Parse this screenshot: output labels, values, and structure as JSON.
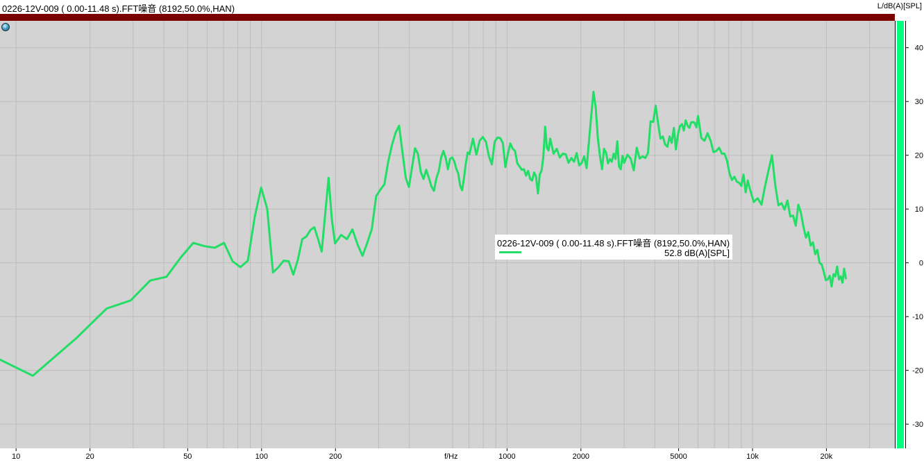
{
  "header": {
    "title": "0226-12V-009 ( 0.00-11.48 s).FFT噪音 (8192,50.0%,HAN)",
    "unit_label": "L/dB(A)[SPL]"
  },
  "legend": {
    "name": "0226-12V-009 ( 0.00-11.48 s).FFT噪音 (8192,50.0%,HAN)",
    "value": "52.8 dB(A)[SPL]"
  },
  "colors": {
    "plot_bg": "#d3d3d3",
    "grid": "#bcbcbc",
    "series": "#22dd66",
    "header_bar": "#7a0000",
    "level_meter": "#00ff7f"
  },
  "level_meter": {
    "fill_fraction": 1.0
  },
  "chart_data": {
    "type": "line",
    "xscale": "log",
    "xlabel": "f/Hz",
    "ylabel": "L/dB(A)[SPL]",
    "xlim": [
      8.6,
      38000
    ],
    "ylim": [
      -34.5,
      45
    ],
    "grid": true,
    "x_ticks": [
      {
        "v": 10,
        "label": "10"
      },
      {
        "v": 20,
        "label": "20"
      },
      {
        "v": 50,
        "label": "50"
      },
      {
        "v": 100,
        "label": "100"
      },
      {
        "v": 200,
        "label": "200"
      },
      {
        "v": 1000,
        "label": "1000"
      },
      {
        "v": 2000,
        "label": "2000"
      },
      {
        "v": 5000,
        "label": "5000"
      },
      {
        "v": 10000,
        "label": "10k"
      },
      {
        "v": 20000,
        "label": "20k"
      }
    ],
    "x_minor": [
      30,
      40,
      60,
      70,
      80,
      90,
      300,
      400,
      600,
      700,
      800,
      900,
      3000,
      4000,
      6000,
      7000,
      8000,
      9000,
      30000
    ],
    "y_ticks": [
      40,
      30,
      20,
      10,
      0,
      -10,
      -20,
      -30
    ],
    "legend_position": "center-right",
    "series": [
      {
        "name": "0226-12V-009 ( 0.00-11.48 s).FFT噪音 (8192,50.0%,HAN)",
        "points": [
          [
            8.6,
            -18
          ],
          [
            11.7,
            -21
          ],
          [
            17.6,
            -14
          ],
          [
            23.4,
            -8.5
          ],
          [
            29.3,
            -7
          ],
          [
            35.2,
            -3.3
          ],
          [
            41.0,
            -2.6
          ],
          [
            46.9,
            1
          ],
          [
            52.7,
            3.7
          ],
          [
            58.6,
            3.1
          ],
          [
            64.5,
            2.8
          ],
          [
            70.3,
            3.7
          ],
          [
            76.2,
            0.3
          ],
          [
            82.0,
            -0.8
          ],
          [
            87.9,
            0.4
          ],
          [
            93.8,
            8.5
          ],
          [
            99.6,
            14
          ],
          [
            105.5,
            10
          ],
          [
            111.3,
            -1.8
          ],
          [
            117.2,
            -0.8
          ],
          [
            123.0,
            0.4
          ],
          [
            128.9,
            0.3
          ],
          [
            134.8,
            -2.2
          ],
          [
            140.6,
            0.6
          ],
          [
            146.5,
            4.4
          ],
          [
            152.3,
            4.9
          ],
          [
            158.2,
            6.1
          ],
          [
            164.1,
            6.6
          ],
          [
            169.9,
            4.4
          ],
          [
            175.8,
            2.1
          ],
          [
            181.6,
            9
          ],
          [
            187.5,
            15.8
          ],
          [
            193.4,
            8
          ],
          [
            199.2,
            3.6
          ],
          [
            205.1,
            4.4
          ],
          [
            211.0,
            5.2
          ],
          [
            222.7,
            4.4
          ],
          [
            234.4,
            6.2
          ],
          [
            246.1,
            3.4
          ],
          [
            257.8,
            1.3
          ],
          [
            269.5,
            3.7
          ],
          [
            281.3,
            6.3
          ],
          [
            293.0,
            12.4
          ],
          [
            304.7,
            13.6
          ],
          [
            316.4,
            14.6
          ],
          [
            328.1,
            18.8
          ],
          [
            339.8,
            21.9
          ],
          [
            351.6,
            24.2
          ],
          [
            363.3,
            25.5
          ],
          [
            375.0,
            20.5
          ],
          [
            386.7,
            15.8
          ],
          [
            398.4,
            14.1
          ],
          [
            410.2,
            17.7
          ],
          [
            421.9,
            21.3
          ],
          [
            433.6,
            20.3
          ],
          [
            445.3,
            16.9
          ],
          [
            457.0,
            15.6
          ],
          [
            468.8,
            17.3
          ],
          [
            480.5,
            15.8
          ],
          [
            492.2,
            14.2
          ],
          [
            503.9,
            13.4
          ],
          [
            515.6,
            15.7
          ],
          [
            527.3,
            17.1
          ],
          [
            539.1,
            19.6
          ],
          [
            550.8,
            20.8
          ],
          [
            562.5,
            19.5
          ],
          [
            574.2,
            17.4
          ],
          [
            586.0,
            19.3
          ],
          [
            597.7,
            19.6
          ],
          [
            609.4,
            18.9
          ],
          [
            621.1,
            17.5
          ],
          [
            632.8,
            16.6
          ],
          [
            644.5,
            14.3
          ],
          [
            656.3,
            13.5
          ],
          [
            668.0,
            15.8
          ],
          [
            679.7,
            18.6
          ],
          [
            691.4,
            20.5
          ],
          [
            703.1,
            20.2
          ],
          [
            726.6,
            23.1
          ],
          [
            750.0,
            20.1
          ],
          [
            773.4,
            22.7
          ],
          [
            796.9,
            23.4
          ],
          [
            820.3,
            22.5
          ],
          [
            843.8,
            19.8
          ],
          [
            867.2,
            18.3
          ],
          [
            890.6,
            22.5
          ],
          [
            914.1,
            23.3
          ],
          [
            937.5,
            23.2
          ],
          [
            960.9,
            22.3
          ],
          [
            984.4,
            17.8
          ],
          [
            1007.8,
            20.3
          ],
          [
            1031.3,
            22.2
          ],
          [
            1054.7,
            21.2
          ],
          [
            1078.1,
            20.8
          ],
          [
            1101.6,
            18.5
          ],
          [
            1125.0,
            17.9
          ],
          [
            1148.4,
            17.3
          ],
          [
            1171.9,
            17.4
          ],
          [
            1195.3,
            16.2
          ],
          [
            1218.8,
            17.1
          ],
          [
            1242.2,
            15.6
          ],
          [
            1265.6,
            15.3
          ],
          [
            1289.1,
            16.8
          ],
          [
            1312.5,
            16.1
          ],
          [
            1336.0,
            12.9
          ],
          [
            1359.4,
            16.4
          ],
          [
            1382.8,
            17.2
          ],
          [
            1406.3,
            19.8
          ],
          [
            1429.7,
            25.3
          ],
          [
            1453.1,
            21.4
          ],
          [
            1476.6,
            20.9
          ],
          [
            1500.0,
            23.1
          ],
          [
            1546.9,
            20.3
          ],
          [
            1593.8,
            21.2
          ],
          [
            1640.6,
            19.6
          ],
          [
            1687.5,
            20.3
          ],
          [
            1734.4,
            20.2
          ],
          [
            1781.3,
            18.6
          ],
          [
            1828.1,
            19.5
          ],
          [
            1875.0,
            18.8
          ],
          [
            1921.9,
            20.4
          ],
          [
            1968.8,
            18.1
          ],
          [
            2015.6,
            18.6
          ],
          [
            2062.5,
            19.8
          ],
          [
            2109.4,
            17.6
          ],
          [
            2156.3,
            22.6
          ],
          [
            2203.1,
            27.4
          ],
          [
            2250.0,
            31.8
          ],
          [
            2296.9,
            28.9
          ],
          [
            2343.8,
            23.2
          ],
          [
            2390.6,
            19.9
          ],
          [
            2437.5,
            17.4
          ],
          [
            2484.4,
            21.2
          ],
          [
            2531.3,
            20.5
          ],
          [
            2578.1,
            18.5
          ],
          [
            2625.0,
            19.3
          ],
          [
            2671.9,
            18.8
          ],
          [
            2718.8,
            20.3
          ],
          [
            2765.6,
            19.3
          ],
          [
            2812.5,
            22.6
          ],
          [
            2859.4,
            17.9
          ],
          [
            2906.3,
            17.4
          ],
          [
            2953.1,
            19.9
          ],
          [
            3000.0,
            18.6
          ],
          [
            3093.8,
            20.1
          ],
          [
            3187.5,
            19.4
          ],
          [
            3281.3,
            17.2
          ],
          [
            3375.0,
            21.4
          ],
          [
            3468.8,
            19.4
          ],
          [
            3562.5,
            19.8
          ],
          [
            3656.3,
            19.5
          ],
          [
            3750.0,
            20.4
          ],
          [
            3843.8,
            26.3
          ],
          [
            3937.5,
            26.2
          ],
          [
            4031.3,
            29.2
          ],
          [
            4125.0,
            25.9
          ],
          [
            4218.8,
            23.1
          ],
          [
            4312.5,
            23.5
          ],
          [
            4406.3,
            22.0
          ],
          [
            4500.0,
            21.6
          ],
          [
            4593.8,
            23.5
          ],
          [
            4687.5,
            22.3
          ],
          [
            4781.3,
            25.1
          ],
          [
            4875.0,
            21.1
          ],
          [
            4968.8,
            23.9
          ],
          [
            5062.5,
            25.4
          ],
          [
            5156.3,
            25.8
          ],
          [
            5250.0,
            24.6
          ],
          [
            5343.8,
            26.5
          ],
          [
            5437.5,
            25.5
          ],
          [
            5531.3,
            25.1
          ],
          [
            5625.0,
            26.1
          ],
          [
            5718.8,
            26.2
          ],
          [
            5812.5,
            26.0
          ],
          [
            5906.3,
            25.2
          ],
          [
            6000.0,
            27.3
          ],
          [
            6187.5,
            23.2
          ],
          [
            6375.0,
            22.7
          ],
          [
            6562.5,
            24.1
          ],
          [
            6750.0,
            22.7
          ],
          [
            6937.5,
            20.6
          ],
          [
            7125.0,
            20.8
          ],
          [
            7312.5,
            21.4
          ],
          [
            7500.0,
            20.3
          ],
          [
            7687.5,
            20.3
          ],
          [
            7875.0,
            19.0
          ],
          [
            8062.5,
            16.6
          ],
          [
            8250.0,
            15.4
          ],
          [
            8437.5,
            16.0
          ],
          [
            8625.0,
            15.1
          ],
          [
            8812.5,
            14.9
          ],
          [
            9000.0,
            14.3
          ],
          [
            9187.5,
            16.4
          ],
          [
            9375.0,
            13.1
          ],
          [
            9562.5,
            15.3
          ],
          [
            9750.0,
            13.8
          ],
          [
            9937.5,
            12.5
          ],
          [
            10125.0,
            11.3
          ],
          [
            10312.5,
            11.7
          ],
          [
            10500.0,
            12.0
          ],
          [
            10875.0,
            10.8
          ],
          [
            11250.0,
            14.3
          ],
          [
            11625.0,
            17.2
          ],
          [
            12000.0,
            20.0
          ],
          [
            12375.0,
            14.5
          ],
          [
            12750.0,
            10.7
          ],
          [
            13125.0,
            11.1
          ],
          [
            13500.0,
            9.9
          ],
          [
            13875.0,
            11.6
          ],
          [
            14250.0,
            8.6
          ],
          [
            14625.0,
            8.8
          ],
          [
            15000.0,
            6.9
          ],
          [
            15375.0,
            10.8
          ],
          [
            15750.0,
            9.3
          ],
          [
            16125.0,
            6.7
          ],
          [
            16500.0,
            4.7
          ],
          [
            16875.0,
            5.7
          ],
          [
            17250.0,
            3.2
          ],
          [
            17625.0,
            3.8
          ],
          [
            18000.0,
            1.6
          ],
          [
            18375.0,
            2.4
          ],
          [
            18750.0,
            0.0
          ],
          [
            19125.0,
            -0.3
          ],
          [
            19500.0,
            -1.6
          ],
          [
            19875.0,
            -3.2
          ],
          [
            20250.0,
            -3.1
          ],
          [
            20625.0,
            -2.4
          ],
          [
            21000.0,
            -4.4
          ],
          [
            21375.0,
            -2.1
          ],
          [
            21750.0,
            -2.5
          ],
          [
            22125.0,
            -0.7
          ],
          [
            22500.0,
            -3.1
          ],
          [
            22875.0,
            -2.5
          ],
          [
            23250.0,
            -3.7
          ],
          [
            23625.0,
            -1.1
          ],
          [
            24000.0,
            -2.9
          ]
        ]
      }
    ]
  }
}
